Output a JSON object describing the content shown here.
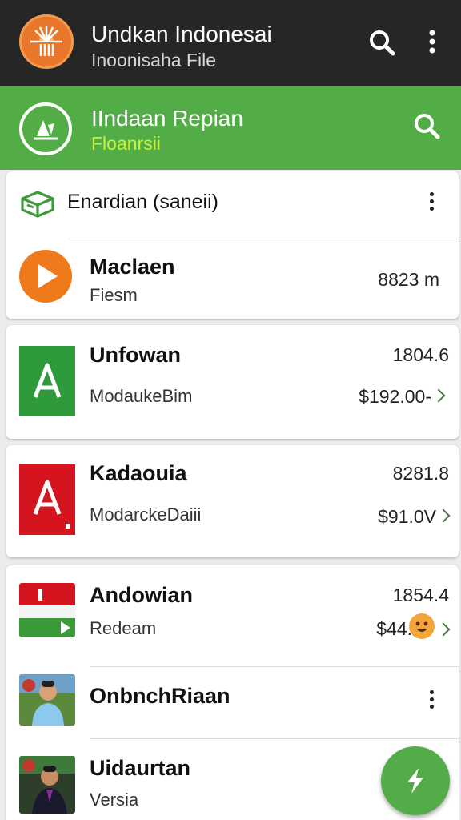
{
  "app_bar": {
    "title": "Undkan Indonesai",
    "subtitle": "Inoonisaha File"
  },
  "sub_bar": {
    "title": "IIndaan Repian",
    "subtitle": "Floanrsii"
  },
  "section_header": {
    "label": "Enardian (saneii)"
  },
  "items": [
    {
      "title": "Maclaen",
      "subtitle": "Fiesm",
      "value": "8823 m"
    },
    {
      "title": "Unfowan",
      "subtitle": "ModaukeBim",
      "value": "1804.6",
      "price": "$192.00-"
    },
    {
      "title": "Kadaouia",
      "subtitle": "ModarckeDaiii",
      "value": "8281.8",
      "price": "$91.0V"
    },
    {
      "title": "Andowian",
      "subtitle": "Redeam",
      "value": "1854.4",
      "price": "$44."
    },
    {
      "title": "OnbnchRiaan"
    },
    {
      "title": "Uidaurtan",
      "subtitle": "Versia"
    }
  ],
  "colors": {
    "app_bar": "#262626",
    "accent_green": "#53ad46",
    "subtitle_lime": "#c8f03c",
    "orange": "#ee7a1c",
    "red": "#d4141f"
  },
  "icons": {
    "app_logo": "sunburst-logo-icon",
    "search": "search-icon",
    "more": "more-vert-icon",
    "section": "box-icon",
    "fab": "bolt-icon"
  }
}
